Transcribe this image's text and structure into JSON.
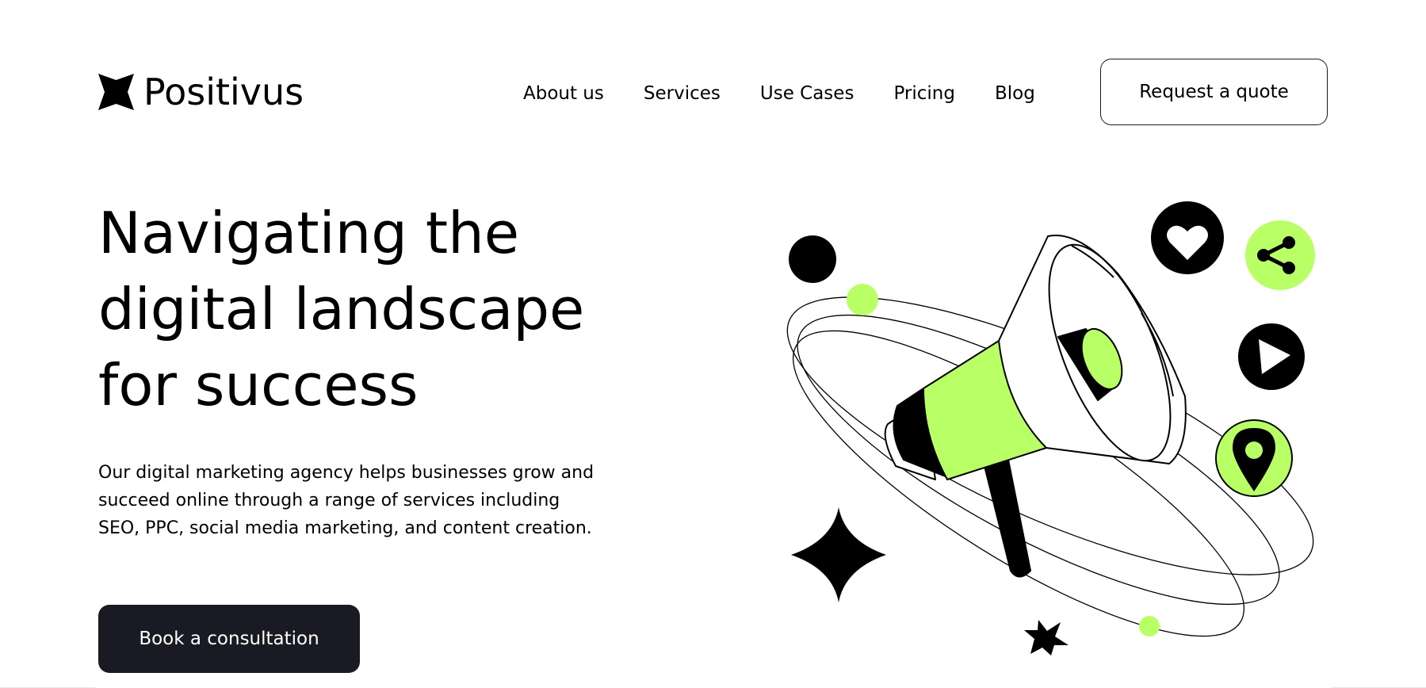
{
  "brand": {
    "name": "Positivus",
    "logo_icon": "star-logo-icon",
    "accent_color": "#B9FF66",
    "dark_color": "#191A23"
  },
  "nav": {
    "items": [
      {
        "label": "About us"
      },
      {
        "label": "Services"
      },
      {
        "label": "Use Cases"
      },
      {
        "label": "Pricing"
      },
      {
        "label": "Blog"
      }
    ],
    "quote_button": "Request a quote"
  },
  "hero": {
    "title_lines": [
      "Navigating the",
      "digital landscape",
      "for success"
    ],
    "description": "Our digital marketing agency helps businesses grow and succeed online through a range of services including SEO, PPC, social media marketing, and content creation.",
    "cta_label": "Book a consultation"
  },
  "illustration": {
    "icons": [
      "megaphone-icon",
      "heart-icon",
      "share-icon",
      "play-icon",
      "location-pin-icon",
      "sparkle-star-icon"
    ]
  }
}
